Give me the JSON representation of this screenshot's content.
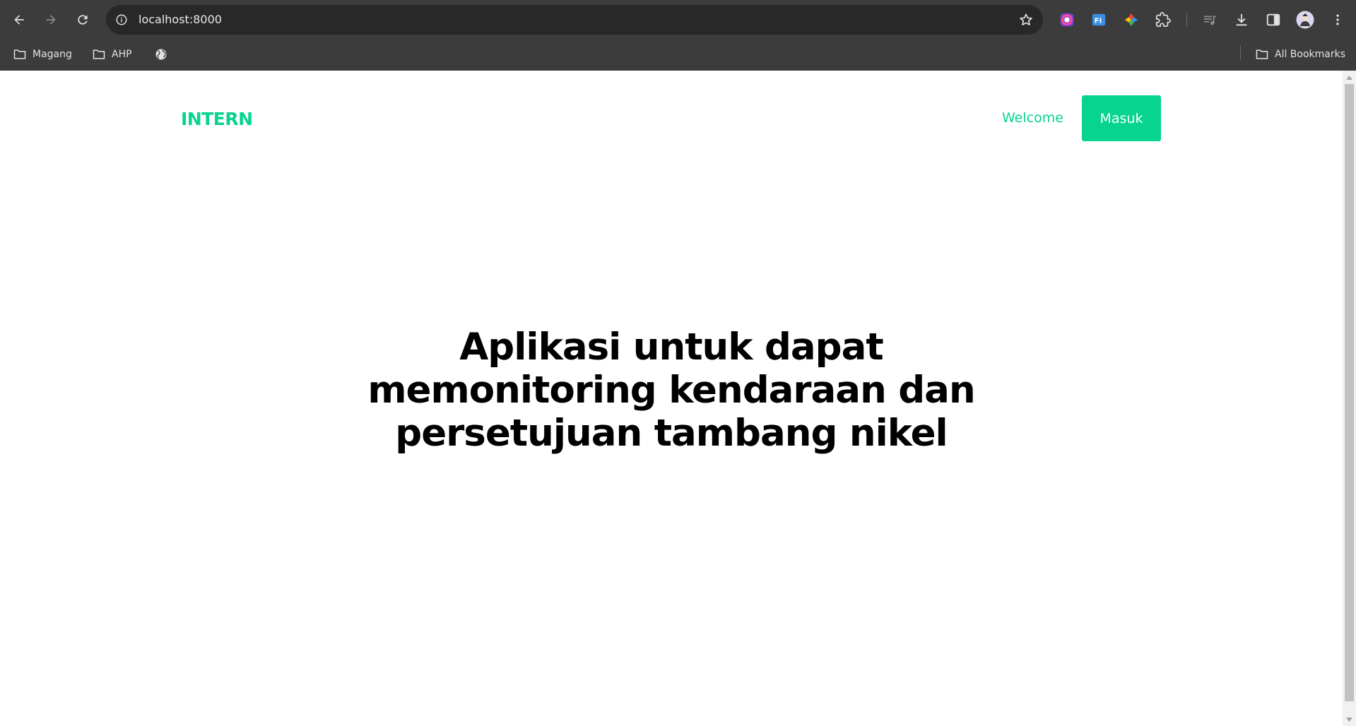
{
  "browser": {
    "url": "localhost:8000",
    "bookmarks": [
      {
        "label": "Magang",
        "icon": "folder-icon"
      },
      {
        "label": "AHP",
        "icon": "folder-icon"
      },
      {
        "label": "",
        "icon": "globe-icon"
      }
    ],
    "all_bookmarks_label": "All Bookmarks",
    "extensions": [
      "color-picker-icon",
      "translate-icon",
      "colorful-extension-icon",
      "puzzle-icon"
    ],
    "toolbar_icons": [
      "media-queue-icon",
      "download-icon",
      "side-panel-icon",
      "avatar",
      "kebab-menu-icon"
    ]
  },
  "site": {
    "brand": "INTERN",
    "nav": {
      "welcome_label": "Welcome",
      "login_label": "Masuk"
    },
    "hero": {
      "title": "Aplikasi untuk dapat memonitoring kendaraan dan persetujuan tambang nikel"
    },
    "accent_color": "#06d48f"
  }
}
